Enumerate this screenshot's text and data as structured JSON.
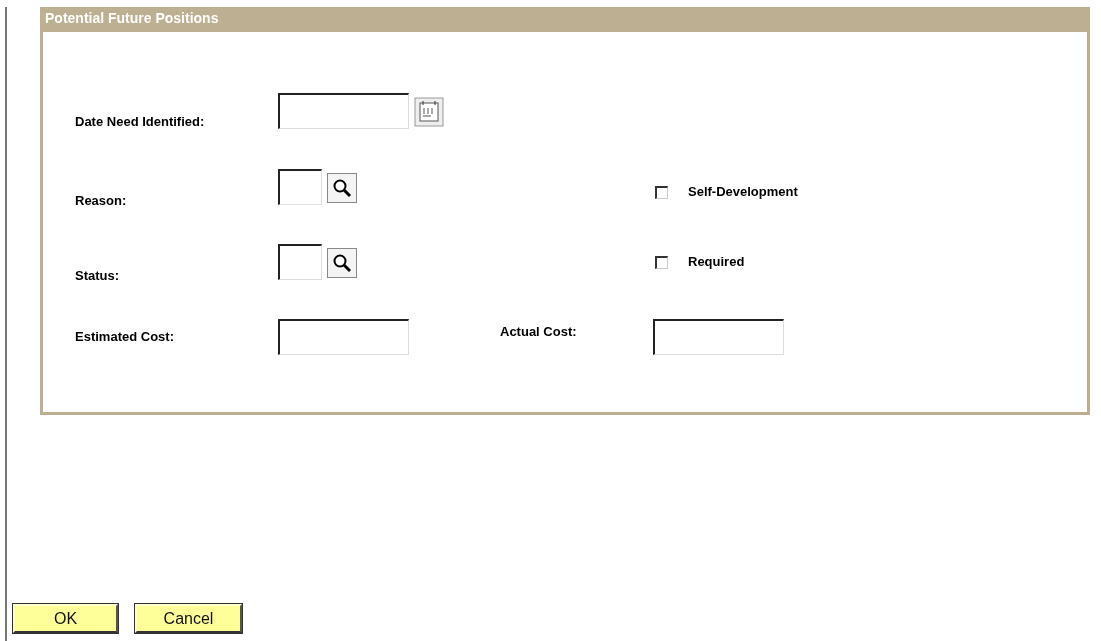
{
  "section": {
    "title": "Potential Future Positions"
  },
  "rows": [
    {
      "field": {
        "label": "Date Need Identified:",
        "kind": "date"
      }
    },
    {
      "field": {
        "label": "Reason:",
        "kind": "lookup"
      },
      "extra": {
        "kind": "checkbox",
        "label": "Self-Development",
        "checked": false
      }
    },
    {
      "field": {
        "label": "Status:",
        "kind": "lookup"
      },
      "extra": {
        "kind": "checkbox",
        "label": "Required",
        "checked": false
      }
    },
    {
      "field": {
        "label": "Estimated Cost:",
        "kind": "text"
      },
      "extra": {
        "kind": "field",
        "label": "Actual Cost:"
      }
    }
  ],
  "buttons": [
    {
      "label": "OK"
    },
    {
      "label": "Cancel"
    }
  ]
}
